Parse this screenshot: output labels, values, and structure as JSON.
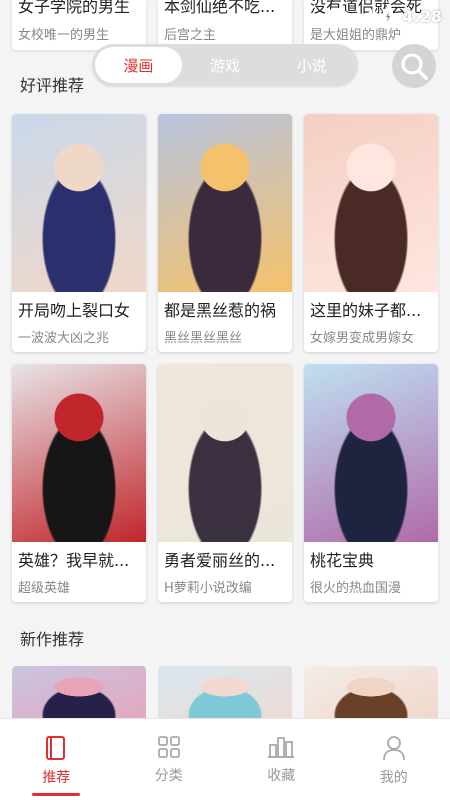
{
  "status_bar": {
    "time": "4:28"
  },
  "top_row": [
    {
      "title": "女子学院的男生",
      "subtitle": "女校唯一的男生"
    },
    {
      "title": "本剑仙绝不吃...",
      "subtitle": "后宫之主"
    },
    {
      "title": "没有道侣就会死",
      "subtitle": "是大姐姐的鼎炉"
    }
  ],
  "segment_tabs": [
    {
      "label": "漫画",
      "active": true
    },
    {
      "label": "游戏",
      "active": false
    },
    {
      "label": "小说",
      "active": false
    }
  ],
  "sections": {
    "recommended": {
      "title": "好评推荐",
      "cards": [
        {
          "title": "开局吻上裂口女",
          "subtitle": "一波波大凶之兆",
          "colors": [
            "#c9d8ea",
            "#2b2f6d",
            "#f0d8c8"
          ]
        },
        {
          "title": "都是黑丝惹的祸",
          "subtitle": "黑丝黑丝黑丝",
          "colors": [
            "#b7c3de",
            "#3a2a3e",
            "#f5c26b"
          ]
        },
        {
          "title": "这里的妹子都...",
          "subtitle": "女嫁男变成男嫁女",
          "colors": [
            "#f3cfc3",
            "#4a2a25",
            "#ffe6df"
          ]
        },
        {
          "title": "英雄？我早就...",
          "subtitle": "超级英雄",
          "colors": [
            "#e8e4e8",
            "#161616",
            "#c0262b"
          ]
        },
        {
          "title": "勇者爱丽丝的...",
          "subtitle": "H萝莉小说改编",
          "colors": [
            "#efe6dc",
            "#3a3040",
            "#ece6da"
          ]
        },
        {
          "title": "桃花宝典",
          "subtitle": "很火的热血国漫",
          "colors": [
            "#bfe0f2",
            "#1e2440",
            "#b06aa8"
          ]
        }
      ]
    },
    "new": {
      "title": "新作推荐",
      "cards": [
        {
          "colors": [
            "#c9c5e0",
            "#26204a",
            "#e7a3b8"
          ]
        },
        {
          "colors": [
            "#d8e8f0",
            "#7fc8d8",
            "#f1d8d0"
          ]
        },
        {
          "colors": [
            "#f3ede8",
            "#6a4026",
            "#f0d4c6"
          ]
        }
      ]
    }
  },
  "bottom_nav": [
    {
      "label": "推荐",
      "icon": "book-icon",
      "active": true
    },
    {
      "label": "分类",
      "icon": "grid-icon",
      "active": false
    },
    {
      "label": "收藏",
      "icon": "bookshelf-icon",
      "active": false
    },
    {
      "label": "我的",
      "icon": "user-icon",
      "active": false
    }
  ],
  "colors": {
    "accent": "#e23030",
    "background": "#f4f4f4",
    "segment_bg": "#dddddd"
  }
}
